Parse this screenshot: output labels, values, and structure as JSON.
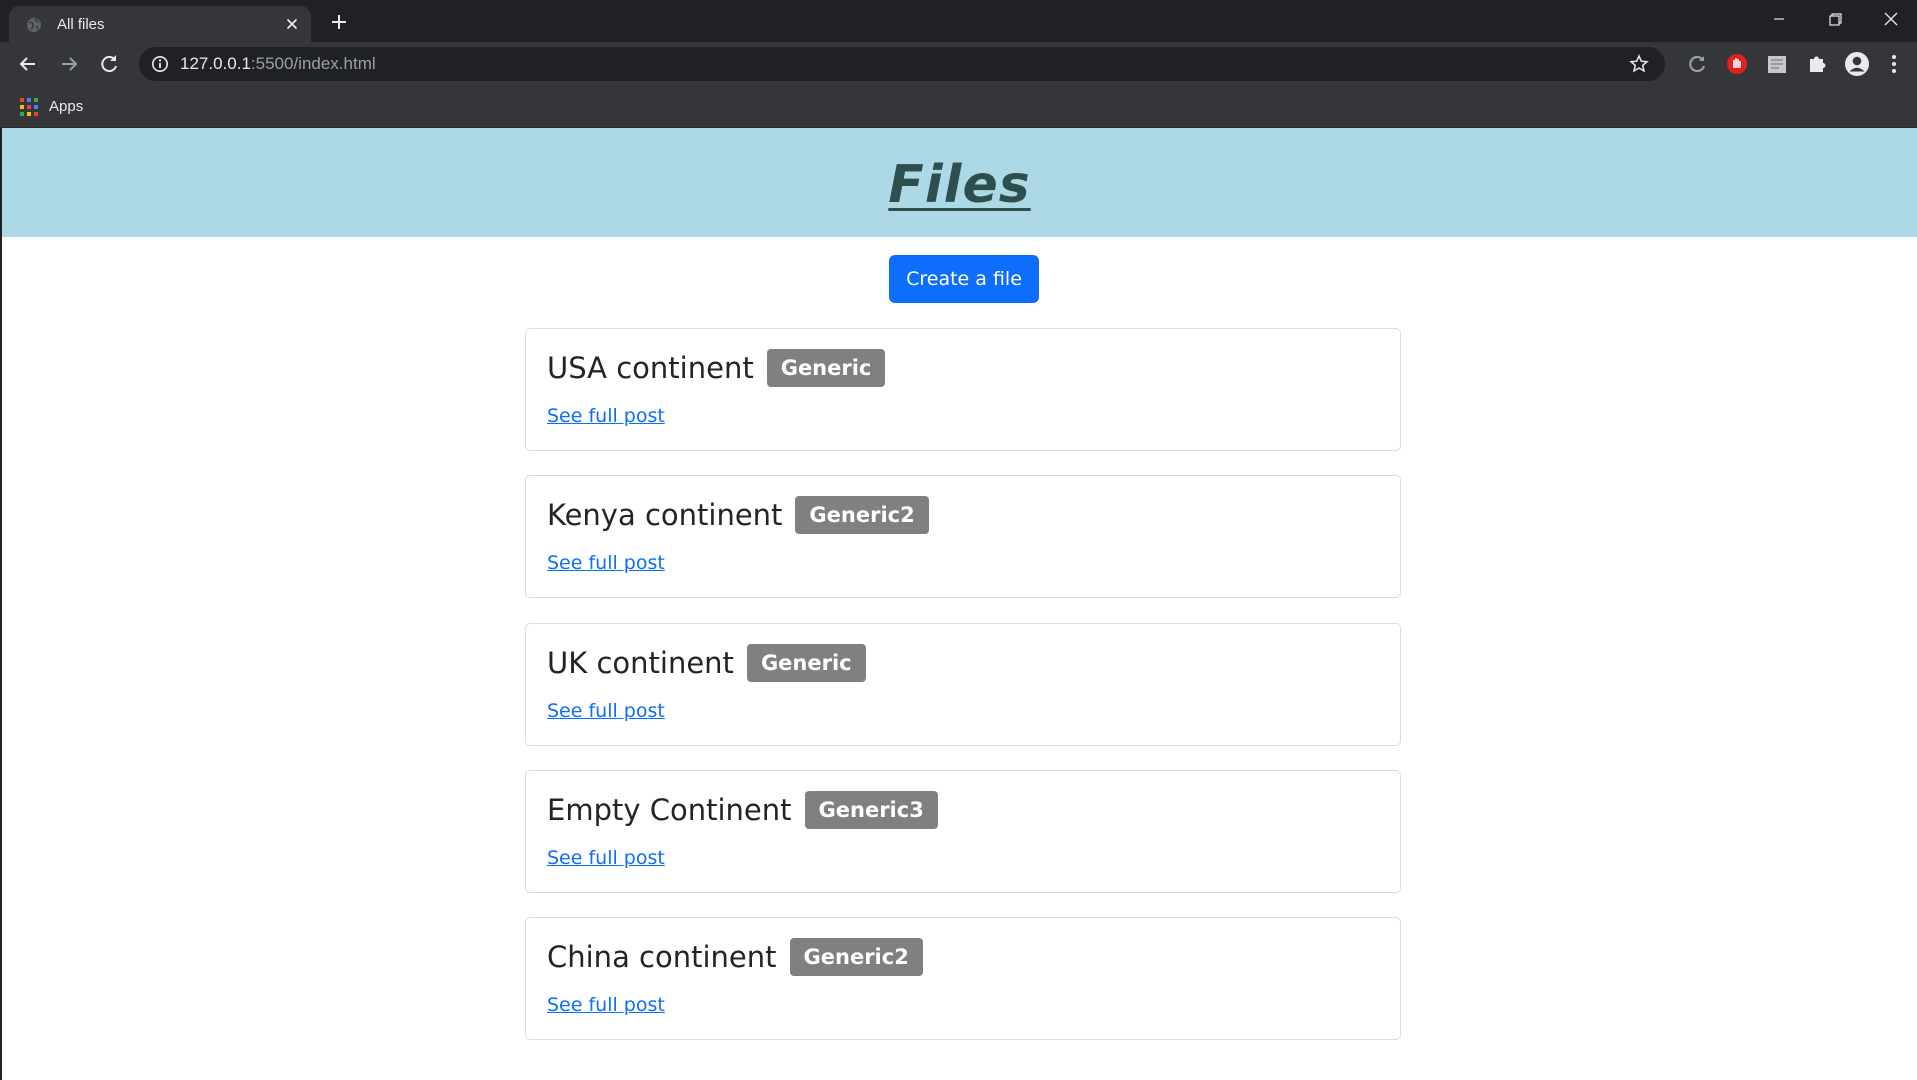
{
  "browser": {
    "tab_title": "All files",
    "url_host": "127.0.0.1",
    "url_path": ":5500/index.html",
    "bookmark_apps": "Apps"
  },
  "page": {
    "heading": "Files",
    "create_button": "Create a file",
    "posts": [
      {
        "title": "USA continent",
        "badge": "Generic",
        "link": "See full post"
      },
      {
        "title": "Kenya continent",
        "badge": "Generic2",
        "link": "See full post"
      },
      {
        "title": "UK continent",
        "badge": "Generic",
        "link": "See full post"
      },
      {
        "title": "Empty Continent",
        "badge": "Generic3",
        "link": "See full post"
      },
      {
        "title": "China continent",
        "badge": "Generic2",
        "link": "See full post"
      }
    ]
  },
  "colors": {
    "header_bg": "#add8e6",
    "header_text": "#2f4f4f",
    "primary_button": "#0d6efd",
    "badge_bg": "#808080",
    "link": "#0d6efd"
  }
}
